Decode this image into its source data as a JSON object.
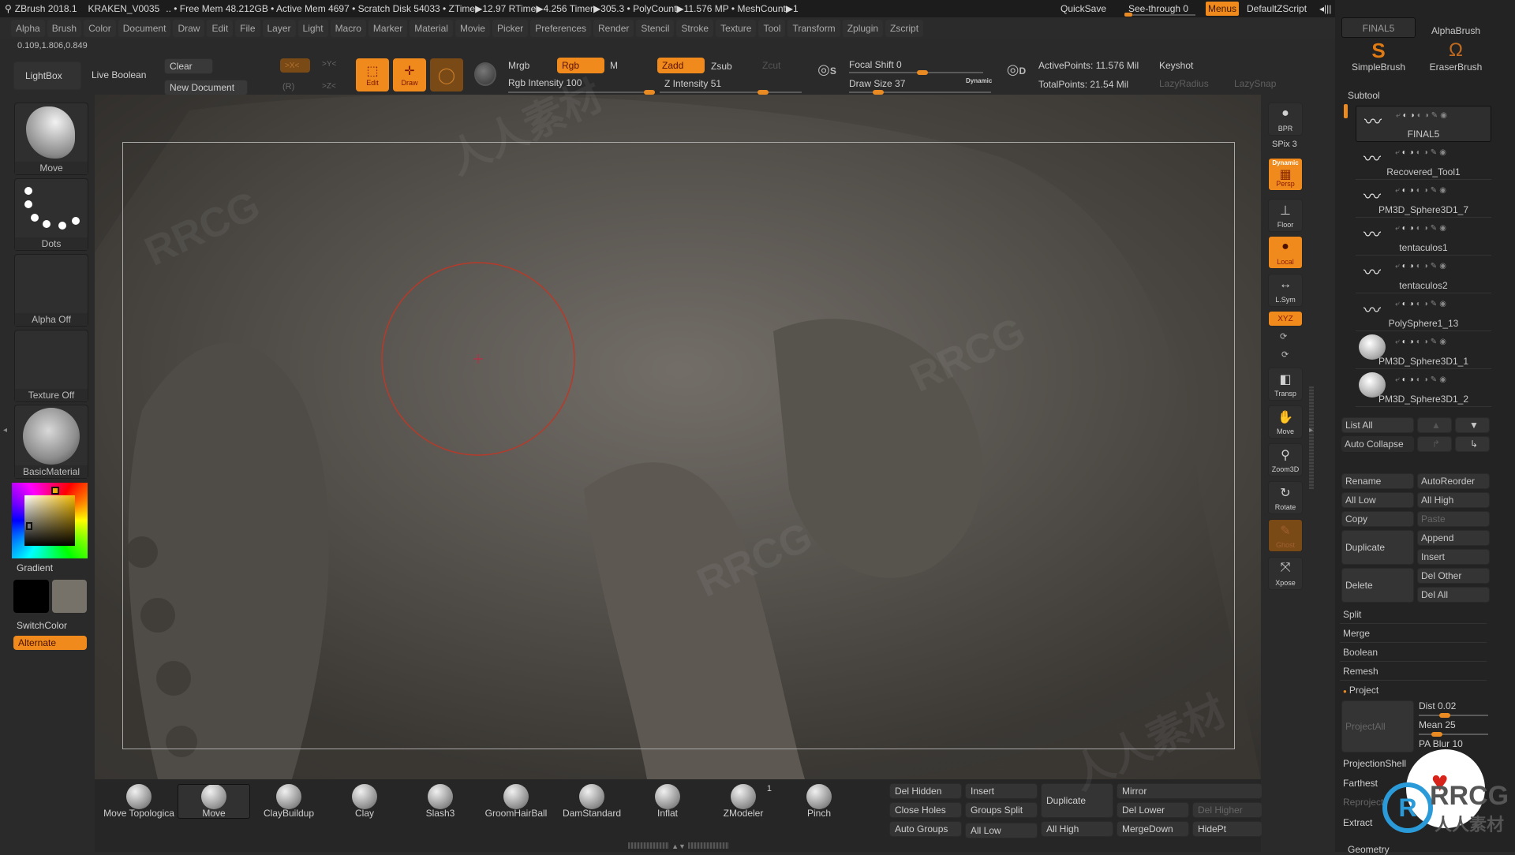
{
  "titlebar": {
    "app": "ZBrush 2018.1",
    "document": "KRAKEN_V0035",
    "stats": ".. • Free Mem 48.212GB • Active Mem 4697 • Scratch Disk 54033 • ZTime▶12.97 RTime▶4.256 Timer▶305.3 • PolyCount▶11.576 MP  • MeshCount▶1",
    "quicksave": "QuickSave",
    "see_through": "See-through  0",
    "see_through_value": 0,
    "menus": "Menus",
    "default_zscript": "DefaultZScript"
  },
  "menubar": [
    "Alpha",
    "Brush",
    "Color",
    "Document",
    "Draw",
    "Edit",
    "File",
    "Layer",
    "Light",
    "Macro",
    "Marker",
    "Material",
    "Movie",
    "Picker",
    "Preferences",
    "Render",
    "Stencil",
    "Stroke",
    "Texture",
    "Tool",
    "Transform",
    "Zplugin",
    "Zscript"
  ],
  "coords": "0.109,1.806,0.849",
  "toolbar": {
    "lightbox": "LightBox",
    "live_boolean": "Live Boolean",
    "clear": "Clear",
    "new_document": "New Document",
    "x_sym": ">X<",
    "y_sym": ">Y<",
    "z_sym": ">Z<",
    "r": "(R)",
    "edit": "Edit",
    "draw": "Draw",
    "mrgb": "Mrgb",
    "rgb": "Rgb",
    "m": "M",
    "rgb_intensity_label": "Rgb Intensity 100",
    "rgb_intensity": 100,
    "zadd": "Zadd",
    "zsub": "Zsub",
    "zcut": "Zcut",
    "z_intensity_label": "Z Intensity 51",
    "z_intensity": 51,
    "focal_shift_label": "Focal Shift 0",
    "focal_shift": 0,
    "draw_size_label": "Draw Size 37",
    "draw_size": 37,
    "dynamic": "Dynamic",
    "active_points": "ActivePoints: 11.576 Mil",
    "total_points": "TotalPoints: 21.54 Mil",
    "keyshot": "Keyshot",
    "lazy_radius": "LazyRadius",
    "lazy_snap": "LazySnap"
  },
  "left_panel": {
    "brush": "Move",
    "stroke": "Dots",
    "alpha": "Alpha Off",
    "texture": "Texture Off",
    "material": "BasicMaterial",
    "gradient": "Gradient",
    "switch_color": "SwitchColor",
    "alternate": "Alternate",
    "main_color": "#000000",
    "secondary_color": "#76726a"
  },
  "right_shelf": {
    "bpr": "BPR",
    "spix": "SPix 3",
    "persp": "Persp",
    "persp_sub": "Dynamic",
    "floor": "Floor",
    "local": "Local",
    "lsym": "L.Sym",
    "xyz": "XYZ",
    "transp": "Transp",
    "move": "Move",
    "zoom3d": "Zoom3D",
    "rotate": "Rotate",
    "ghost": "Ghost",
    "xpose": "Xpose"
  },
  "tool_palette": {
    "current_tool": "FINAL5",
    "brushes": [
      "AlphaBrush",
      "SimpleBrush",
      "EraserBrush"
    ],
    "subtool_title": "Subtool",
    "subtools": [
      "FINAL5",
      "Recovered_Tool1",
      "PM3D_Sphere3D1_7",
      "tentaculos1",
      "tentaculos2",
      "PolySphere1_13",
      "PM3D_Sphere3D1_1",
      "PM3D_Sphere3D1_2"
    ],
    "list_all": "List All",
    "auto_collapse": "Auto Collapse",
    "rename": "Rename",
    "auto_reorder": "AutoReorder",
    "all_low": "All Low",
    "all_high": "All High",
    "copy": "Copy",
    "paste": "Paste",
    "duplicate": "Duplicate",
    "append": "Append",
    "insert": "Insert",
    "delete": "Delete",
    "del_other": "Del Other",
    "del_all": "Del All",
    "split": "Split",
    "merge": "Merge",
    "boolean": "Boolean",
    "remesh": "Remesh",
    "project": "Project",
    "project_all": "ProjectAll",
    "dist": "Dist 0.02",
    "mean": "Mean 25",
    "pa_blur": "PA Blur 10",
    "projection_shell": "ProjectionShell",
    "farthest": "Farthest",
    "reproject": "Reproject",
    "extract": "Extract",
    "geometry": "Geometry"
  },
  "bottom_brushes": [
    {
      "name": "Move Topologica"
    },
    {
      "name": "Move"
    },
    {
      "name": "ClayBuildup"
    },
    {
      "name": "Clay"
    },
    {
      "name": "Slash3"
    },
    {
      "name": "GroomHairBall"
    },
    {
      "name": "DamStandard"
    },
    {
      "name": "Inflat"
    },
    {
      "name": "ZModeler",
      "badge": "1"
    },
    {
      "name": "Pinch"
    }
  ],
  "bottom_geometry": {
    "del_hidden": "Del Hidden",
    "insert": "Insert",
    "duplicate": "Duplicate",
    "mirror": "Mirror",
    "close_holes": "Close Holes",
    "groups_split": "Groups Split",
    "del_lower": "Del Lower",
    "del_higher": "Del Higher",
    "auto_groups": "Auto Groups",
    "all_low": "All Low",
    "all_high": "All High",
    "merge_down": "MergeDown",
    "hide_pt": "HidePt"
  },
  "watermark": "RRCG",
  "watermark_cn": "人人素材",
  "accent": "#f08a1c"
}
